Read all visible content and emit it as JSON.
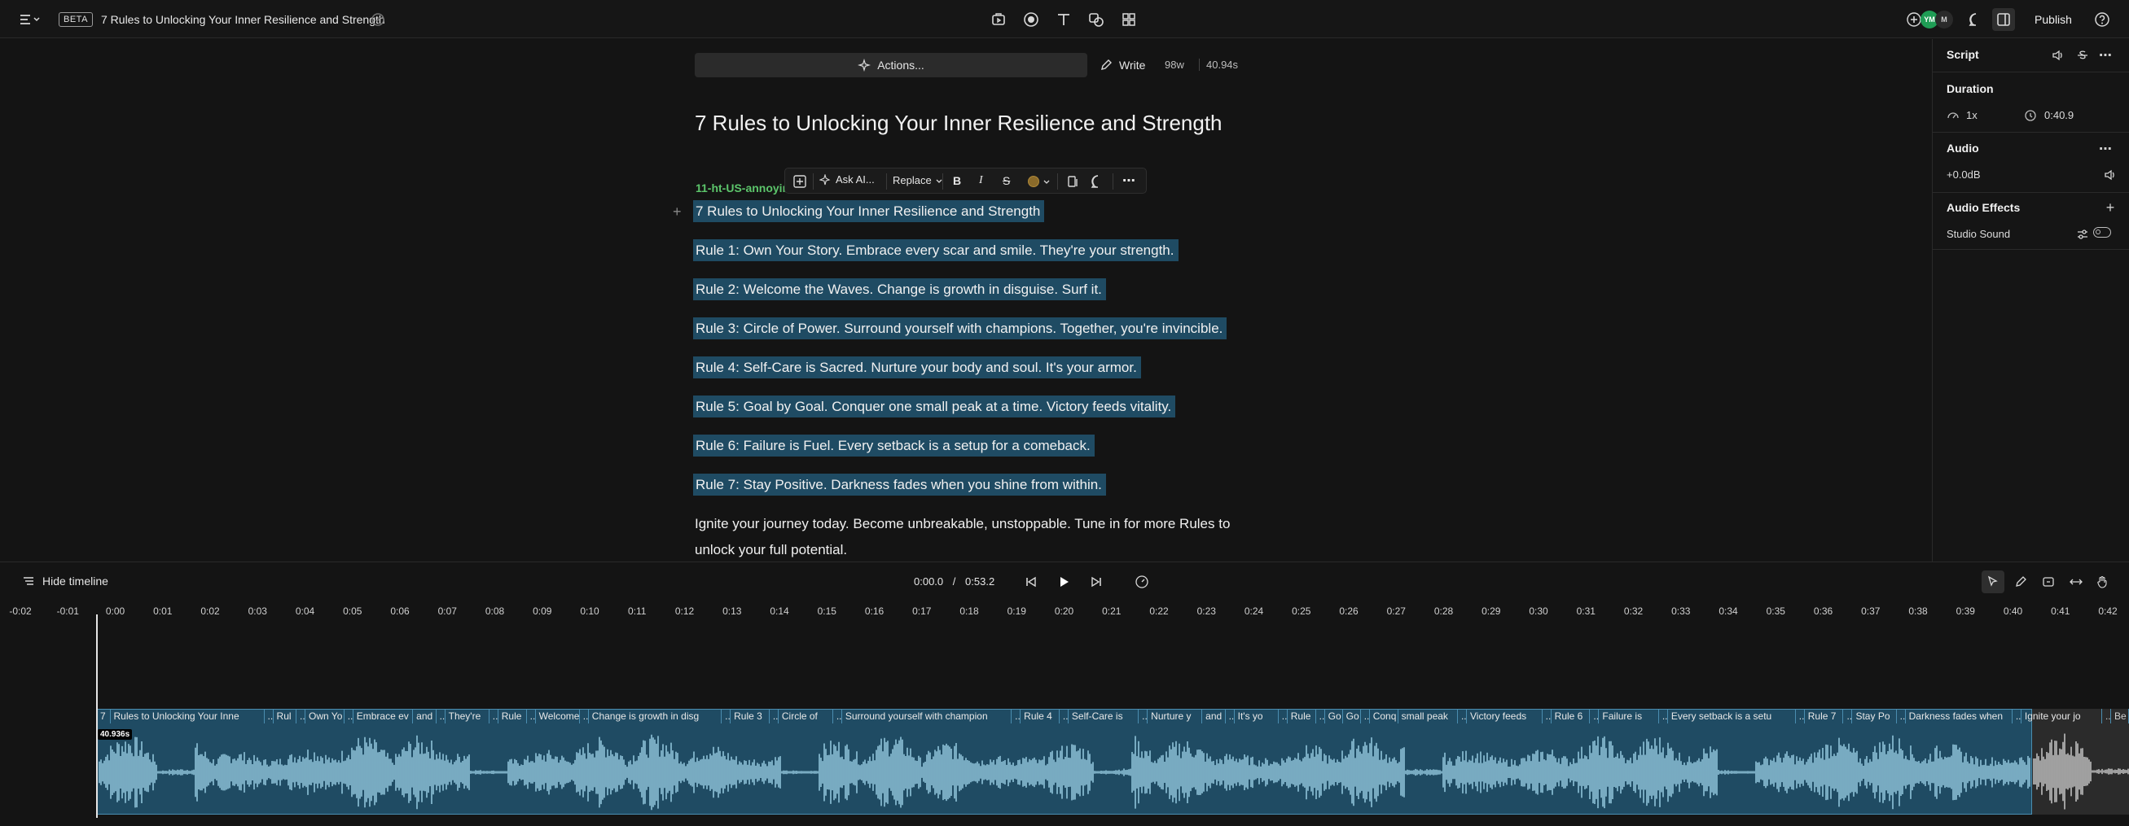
{
  "topbar": {
    "beta": "BETA",
    "title": "7 Rules to Unlocking Your Inner Resilience and Strength",
    "avatars": [
      "YM",
      "M"
    ],
    "publish": "Publish"
  },
  "editor": {
    "actions_label": "Actions...",
    "write_label": "Write",
    "word_count": "98w",
    "duration": "40.94s",
    "script_title": "7 Rules to Unlocking Your Inner Resilience and Strength",
    "speaker": "11-ht-US-annoyin",
    "toolbar": {
      "ask_ai": "Ask AI...",
      "replace": "Replace",
      "bold": "B",
      "italic": "I",
      "strike": "S",
      "more": "⋯"
    },
    "paragraphs": [
      "7 Rules to Unlocking Your Inner Resilience and Strength",
      "Rule 1: Own Your Story. Embrace every scar and smile. They're your strength.",
      "Rule 2: Welcome the Waves. Change is growth in disguise. Surf it.",
      "Rule 3: Circle of Power. Surround yourself with champions. Together, you're invincible.",
      "Rule 4: Self-Care is Sacred. Nurture your body and soul. It's your armor.",
      "Rule 5: Goal by Goal. Conquer one small peak at a time. Victory feeds vitality.",
      "Rule 6: Failure is Fuel. Every setback is a setup for a comeback.",
      "Rule 7: Stay Positive. Darkness fades when you shine from within."
    ],
    "closing_line1": "Ignite your journey today. Become unbreakable, unstoppable. Tune in for more Rules to",
    "closing_line2": "unlock your full potential."
  },
  "right_panel": {
    "script_label": "Script",
    "duration_label": "Duration",
    "speed": "1x",
    "duration_value": "0:40.9",
    "audio_label": "Audio",
    "gain": "+0.0dB",
    "effects_label": "Audio Effects",
    "studio_sound": "Studio Sound"
  },
  "timeline": {
    "hide_label": "Hide timeline",
    "current_time": "0:00.0",
    "separator": "/",
    "total_time": "0:53.2",
    "playhead_badge": "40.936s",
    "ticks": [
      "-0:02",
      "-0:01",
      "0:00",
      "0:01",
      "0:02",
      "0:03",
      "0:04",
      "0:05",
      "0:06",
      "0:07",
      "0:08",
      "0:09",
      "0:10",
      "0:11",
      "0:12",
      "0:13",
      "0:14",
      "0:15",
      "0:16",
      "0:17",
      "0:18",
      "0:19",
      "0:20",
      "0:21",
      "0:22",
      "0:23",
      "0:24",
      "0:25",
      "0:26",
      "0:27",
      "0:28",
      "0:29",
      "0:30",
      "0:31",
      "0:32",
      "0:33",
      "0:34",
      "0:35",
      "0:36",
      "0:37",
      "0:38",
      "0:39",
      "0:40",
      "0:41",
      "0:42"
    ],
    "words": [
      "7",
      "Rules to Unlocking Your Inne",
      "...",
      "Rul",
      "...",
      "Own Yo",
      "...",
      "Embrace ev",
      "and",
      "...",
      "They're",
      "...",
      "Rule",
      "...",
      "Welcome",
      "...",
      "Change is growth in disg",
      "...",
      "Rule 3",
      "...",
      "Circle of",
      "...",
      "Surround yourself with champion",
      "...",
      "Rule 4",
      "...",
      "Self-Care is",
      "...",
      "Nurture y",
      "and",
      "...",
      "It's yo",
      "...",
      "Rule",
      "...",
      "Go",
      "Go",
      "...",
      "Conq",
      "small peak",
      "...",
      "Victory feeds",
      "...",
      "Rule 6",
      "...",
      "Failure is",
      "...",
      "Every setback is a setu",
      "...",
      "Rule 7",
      "...",
      "Stay Po",
      "...",
      "Darkness fades when",
      "...",
      "Ignite your jo",
      "...",
      "Be"
    ]
  },
  "colors": {
    "highlight": "#1f4b63",
    "speaker": "#5cc56b",
    "waveform": "#8fc3d9",
    "avatar_green": "#1f9d55"
  }
}
